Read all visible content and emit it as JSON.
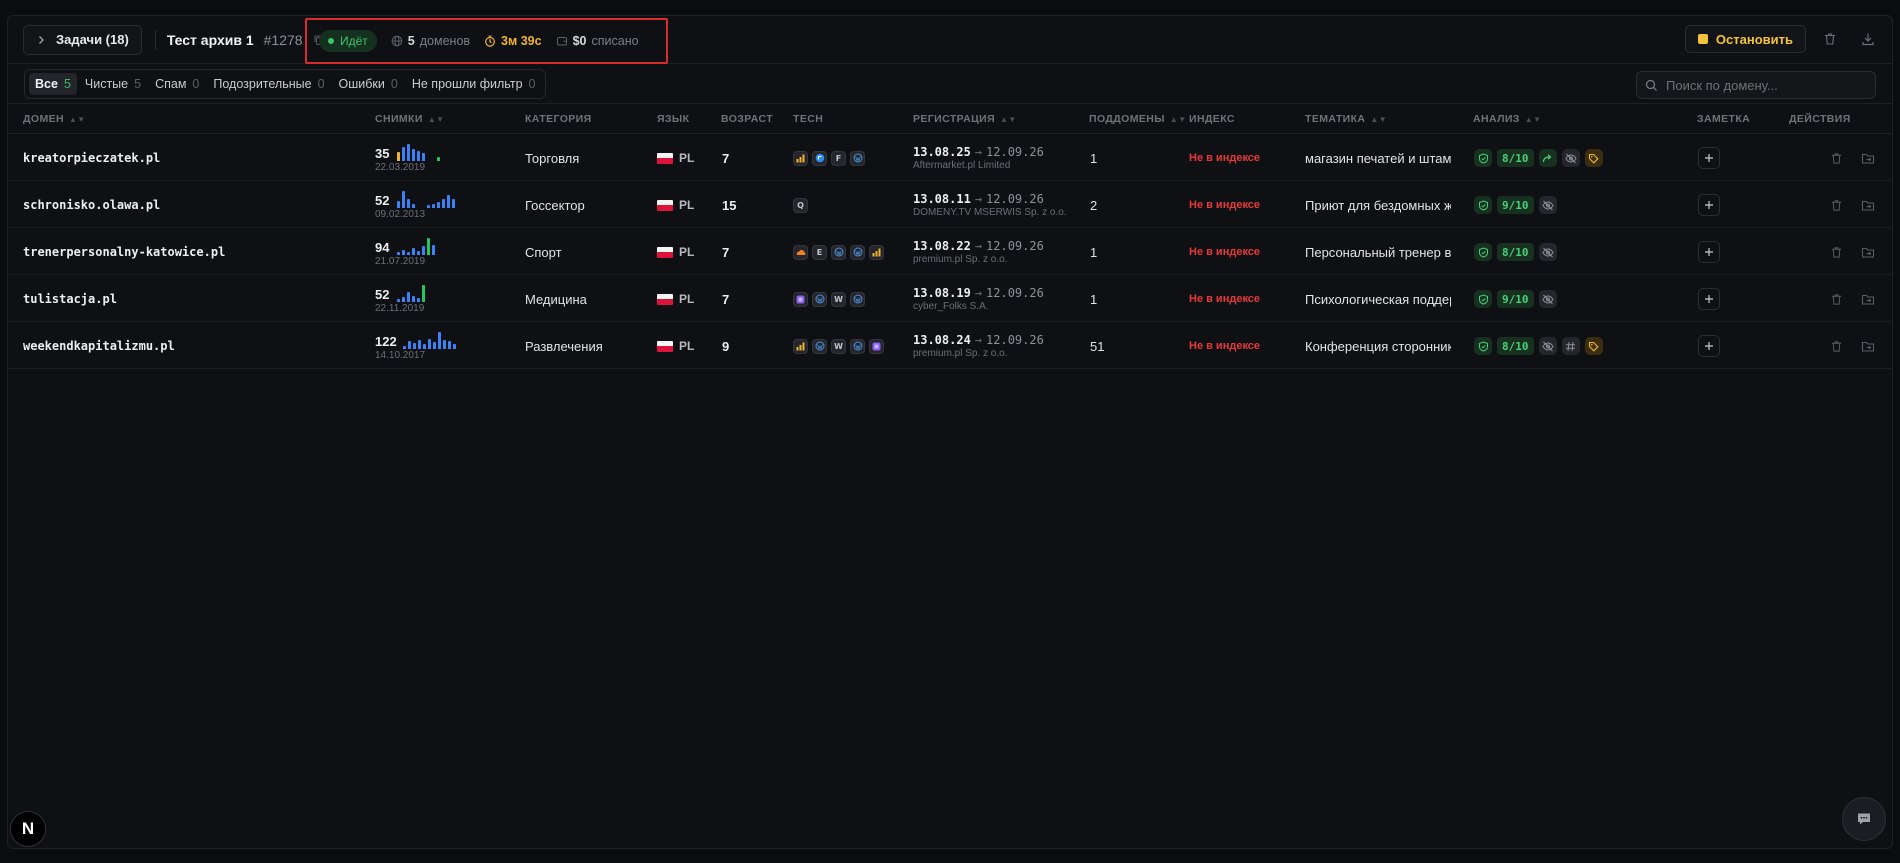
{
  "topbar": {
    "tasks_label": "Задачи (18)",
    "job_title": "Тест архив 1",
    "job_id": "#1278",
    "status_label": "Идёт",
    "domains_count": "5",
    "domains_label": "доменов",
    "timer": "3м 39с",
    "cost_value": "$0",
    "cost_label": "списано",
    "stop_label": "Остановить"
  },
  "filters": [
    {
      "label": "Все",
      "count": "5",
      "active": true
    },
    {
      "label": "Чистые",
      "count": "5"
    },
    {
      "label": "Спам",
      "count": "0"
    },
    {
      "label": "Подозрительные",
      "count": "0"
    },
    {
      "label": "Ошибки",
      "count": "0"
    },
    {
      "label": "Не прошли фильтр",
      "count": "0"
    }
  ],
  "search": {
    "placeholder": "Поиск по домену..."
  },
  "columns": {
    "domain": "ДОМЕН",
    "snapshots": "СНИМКИ",
    "category": "КАТЕГОРИЯ",
    "language": "ЯЗЫК",
    "age": "ВОЗРАСТ",
    "tech": "TECH",
    "registration": "РЕГИСТРАЦИЯ",
    "subdomains": "ПОДДОМЕНЫ",
    "index": "ИНДЕКС",
    "topic": "ТЕМАТИКА",
    "analysis": "АНАЛИЗ",
    "note": "ЗАМЕТКА",
    "actions": "ДЕЙСТВИЯ"
  },
  "rows": [
    {
      "domain": "kreatorpieczatek.pl",
      "snapshots": "35",
      "snapshot_date": "22.03.2019",
      "bars": [
        {
          "v": 0.55,
          "c": "#f1b42f"
        },
        {
          "v": 0.85,
          "c": "#3b82f6"
        },
        {
          "v": 1,
          "c": "#3b82f6"
        },
        {
          "v": 0.7,
          "c": "#3b82f6"
        },
        {
          "v": 0.6,
          "c": "#3b82f6"
        },
        {
          "v": 0.45,
          "c": "#3b82f6"
        },
        {
          "v": 0,
          "c": "#3b82f6"
        },
        {
          "v": 0,
          "c": "#3b82f6"
        },
        {
          "v": 0.25,
          "c": "#22c55e"
        }
      ],
      "category": "Торговля",
      "language": "PL",
      "age": "7",
      "tech": [
        "bars-icon",
        "cloud-icon",
        "F",
        "wp-icon"
      ],
      "reg_created": "13.08.25",
      "reg_expires": "12.09.26",
      "registrar": "Aftermarket.pl Limited",
      "subdomains": "1",
      "index_status": "Не в индексе",
      "topic": "магазин печатей и штампов",
      "score": "8/10",
      "analysis_icons": [
        "redirect-icon",
        "eye-off-icon",
        "tag-icon"
      ]
    },
    {
      "domain": "schronisko.olawa.pl",
      "snapshots": "52",
      "snapshot_date": "09.02.2013",
      "bars": [
        {
          "v": 0.4,
          "c": "#3b82f6"
        },
        {
          "v": 1,
          "c": "#3b82f6"
        },
        {
          "v": 0.55,
          "c": "#3b82f6"
        },
        {
          "v": 0.25,
          "c": "#3b82f6"
        },
        {
          "v": 0,
          "c": "#3b82f6"
        },
        {
          "v": 0,
          "c": "#3b82f6"
        },
        {
          "v": 0.15,
          "c": "#3b82f6"
        },
        {
          "v": 0.25,
          "c": "#3b82f6"
        },
        {
          "v": 0.35,
          "c": "#3b82f6"
        },
        {
          "v": 0.5,
          "c": "#3b82f6"
        },
        {
          "v": 0.75,
          "c": "#3b82f6"
        },
        {
          "v": 0.55,
          "c": "#3b82f6"
        }
      ],
      "category": "Госсектор",
      "language": "PL",
      "age": "15",
      "tech": [
        "Q"
      ],
      "reg_created": "13.08.11",
      "reg_expires": "12.09.26",
      "registrar": "DOMENY.TV MSERWIS Sp. z o.o.",
      "subdomains": "2",
      "index_status": "Не в индексе",
      "topic": "Приют для бездомных животных",
      "score": "9/10",
      "analysis_icons": [
        "eye-off-icon"
      ]
    },
    {
      "domain": "trenerpersonalny-katowice.pl",
      "snapshots": "94",
      "snapshot_date": "21.07.2019",
      "bars": [
        {
          "v": 0.15,
          "c": "#3b82f6"
        },
        {
          "v": 0.3,
          "c": "#3b82f6"
        },
        {
          "v": 0.15,
          "c": "#3b82f6"
        },
        {
          "v": 0.4,
          "c": "#3b82f6"
        },
        {
          "v": 0.25,
          "c": "#3b82f6"
        },
        {
          "v": 0.5,
          "c": "#3b82f6"
        },
        {
          "v": 1,
          "c": "#22c55e"
        },
        {
          "v": 0.6,
          "c": "#3b82f6"
        }
      ],
      "category": "Спорт",
      "language": "PL",
      "age": "7",
      "tech": [
        "cloud-orange-icon",
        "E",
        "wp-icon",
        "wp-icon",
        "bars-icon"
      ],
      "reg_created": "13.08.22",
      "reg_expires": "12.09.26",
      "registrar": "premium.pl Sp. z o.o.",
      "subdomains": "1",
      "index_status": "Не в индексе",
      "topic": "Персональный тренер в Катовице",
      "score": "8/10",
      "analysis_icons": [
        "eye-off-icon"
      ]
    },
    {
      "domain": "tulistacja.pl",
      "snapshots": "52",
      "snapshot_date": "22.11.2019",
      "bars": [
        {
          "v": 0.15,
          "c": "#3b82f6"
        },
        {
          "v": 0.3,
          "c": "#3b82f6"
        },
        {
          "v": 0.6,
          "c": "#3b82f6"
        },
        {
          "v": 0.35,
          "c": "#3b82f6"
        },
        {
          "v": 0.25,
          "c": "#3b82f6"
        },
        {
          "v": 1,
          "c": "#22c55e"
        }
      ],
      "category": "Медицина",
      "language": "PL",
      "age": "7",
      "tech": [
        "box-icon",
        "wp-icon",
        "W",
        "wp-icon"
      ],
      "reg_created": "13.08.19",
      "reg_expires": "12.09.26",
      "registrar": "cyber_Folks S.A.",
      "subdomains": "1",
      "index_status": "Не в индексе",
      "topic": "Психологическая поддержка",
      "score": "9/10",
      "analysis_icons": [
        "eye-off-icon"
      ]
    },
    {
      "domain": "weekendkapitalizmu.pl",
      "snapshots": "122",
      "snapshot_date": "14.10.2017",
      "bars": [
        {
          "v": 0.2,
          "c": "#3b82f6"
        },
        {
          "v": 0.45,
          "c": "#3b82f6"
        },
        {
          "v": 0.35,
          "c": "#3b82f6"
        },
        {
          "v": 0.55,
          "c": "#3b82f6"
        },
        {
          "v": 0.3,
          "c": "#3b82f6"
        },
        {
          "v": 0.6,
          "c": "#3b82f6"
        },
        {
          "v": 0.4,
          "c": "#3b82f6"
        },
        {
          "v": 1,
          "c": "#3b82f6"
        },
        {
          "v": 0.5,
          "c": "#3b82f6"
        },
        {
          "v": 0.45,
          "c": "#3b82f6"
        },
        {
          "v": 0.3,
          "c": "#3b82f6"
        }
      ],
      "category": "Развлечения",
      "language": "PL",
      "age": "9",
      "tech": [
        "bars-icon",
        "wp-icon",
        "W",
        "wp-icon",
        "box-icon"
      ],
      "reg_created": "13.08.24",
      "reg_expires": "12.09.26",
      "registrar": "premium.pl Sp. z o.o.",
      "subdomains": "51",
      "index_status": "Не в индексе",
      "topic": "Конференция сторонников капитализма",
      "score": "8/10",
      "analysis_icons": [
        "eye-off-icon",
        "hash-icon",
        "tag-icon"
      ]
    }
  ],
  "footer": {
    "logo_letter": "N"
  },
  "colors": {
    "accent": "#f3c33b",
    "success": "#3ec46b",
    "danger": "#e6393a",
    "highlight": "#d92c2c"
  }
}
